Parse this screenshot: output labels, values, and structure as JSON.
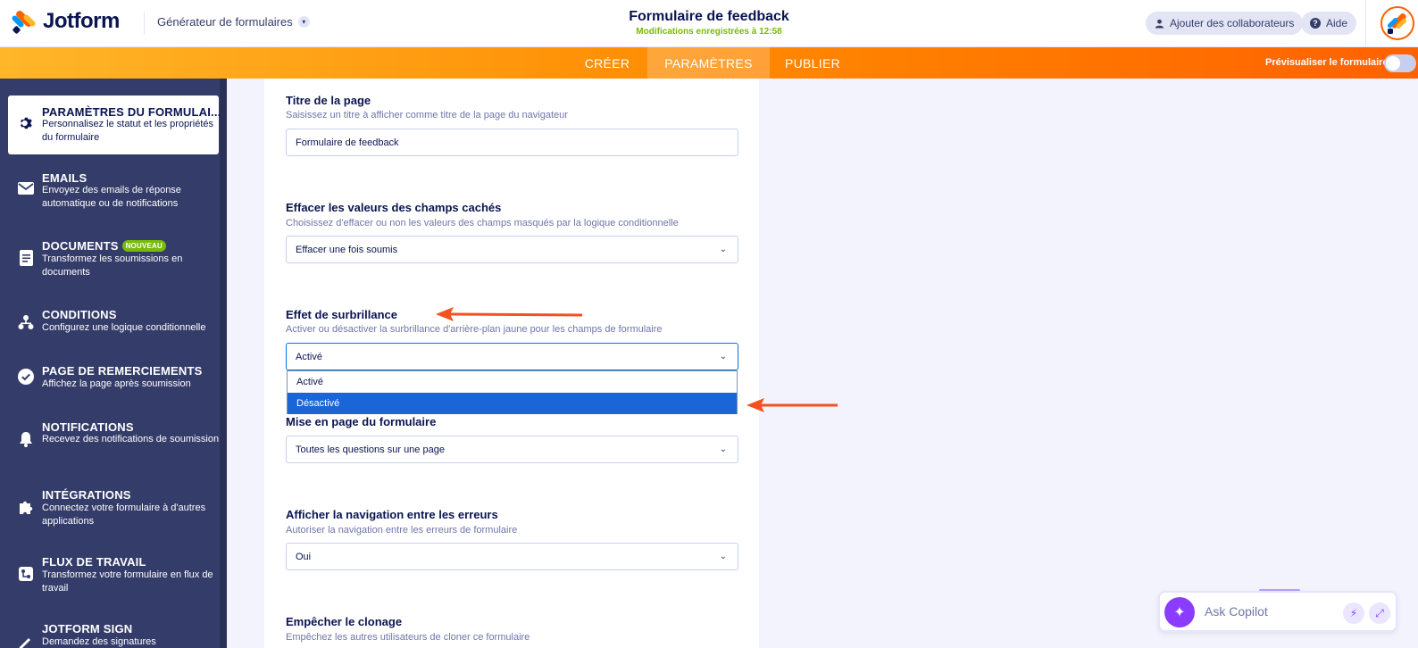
{
  "header": {
    "logo_text": "Jotform",
    "builder_label": "Générateur de formulaires",
    "form_title": "Formulaire de feedback",
    "saved_status": "Modifications enregistrées à 12:58",
    "add_collaborators": "Ajouter des collaborateurs",
    "help": "Aide"
  },
  "nav": {
    "tabs": [
      {
        "label": "CRÉER"
      },
      {
        "label": "PARAMÈTRES",
        "active": true
      },
      {
        "label": "PUBLIER"
      }
    ],
    "preview_label": "Prévisualiser le formulaire",
    "preview_enabled": false
  },
  "sidebar": {
    "items": [
      {
        "title": "PARAMÈTRES DU FORMULAI...",
        "desc": "Personnalisez le statut et les propriétés du formulaire",
        "icon": "gear-icon",
        "active": true
      },
      {
        "title": "EMAILS",
        "desc": "Envoyez des emails de réponse automatique ou de notifications",
        "icon": "envelope-icon"
      },
      {
        "title": "DOCUMENTS",
        "badge": "NOUVEAU",
        "desc": "Transformez les soumissions en documents",
        "icon": "document-icon"
      },
      {
        "title": "CONDITIONS",
        "desc": "Configurez une logique conditionnelle",
        "icon": "sitemap-icon"
      },
      {
        "title": "PAGE DE REMERCIEMENTS",
        "desc": "Affichez la page après soumission",
        "icon": "check-circle-icon"
      },
      {
        "title": "NOTIFICATIONS",
        "desc": "Recevez des notifications de soumission",
        "icon": "bell-icon"
      },
      {
        "title": "INTÉGRATIONS",
        "desc": "Connectez votre formulaire à d'autres applications",
        "icon": "puzzle-icon"
      },
      {
        "title": "FLUX DE TRAVAIL",
        "desc": "Transformez votre formulaire en flux de travail",
        "icon": "workflow-icon"
      },
      {
        "title": "JOTFORM SIGN",
        "desc": "Demandez des signatures",
        "icon": "signature-icon"
      }
    ]
  },
  "settings": {
    "page_title": {
      "label": "Titre de la page",
      "desc": "Saisissez un titre à afficher comme titre de la page du navigateur",
      "value": "Formulaire de feedback"
    },
    "clear_hidden": {
      "label": "Effacer les valeurs des champs cachés",
      "desc": "Choisissez d'effacer ou non les valeurs des champs masqués par la logique conditionnelle",
      "value": "Effacer une fois soumis"
    },
    "highlight": {
      "label": "Effet de surbrillance",
      "desc": "Activer ou désactiver la surbrillance d'arrière-plan jaune pour les champs de formulaire",
      "value": "Activé",
      "options": [
        "Activé",
        "Désactivé"
      ],
      "hovered_option": "Désactivé"
    },
    "layout": {
      "label": "Mise en page du formulaire",
      "value": "Toutes les questions sur une page"
    },
    "error_nav": {
      "label": "Afficher la navigation entre les erreurs",
      "desc": "Autoriser la navigation entre les erreurs de formulaire",
      "value": "Oui"
    },
    "prevent_clone": {
      "label": "Empêcher le clonage",
      "desc": "Empêchez les autres utilisateurs de cloner ce formulaire"
    }
  },
  "copilot": {
    "placeholder": "Ask Copilot"
  },
  "colors": {
    "brand_orange": "#ff6100",
    "sidebar_bg": "#343c6a",
    "selected_option": "#1b66d6",
    "saved_green": "#78bb07",
    "annotation_arrow": "#f4511e"
  }
}
